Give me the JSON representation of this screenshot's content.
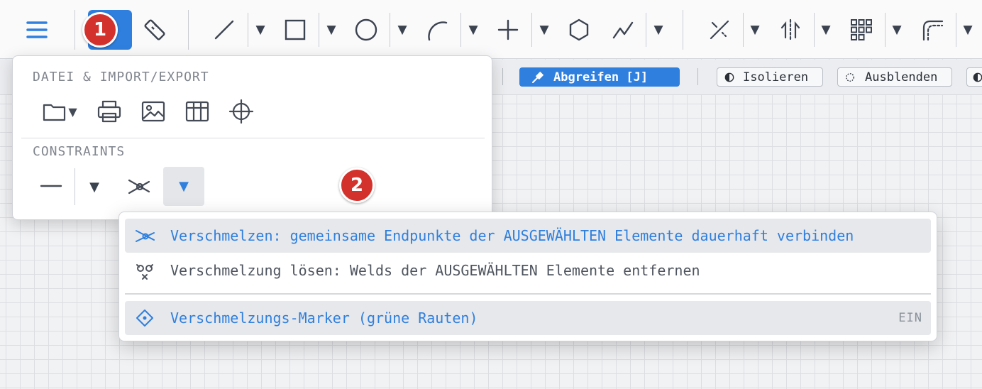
{
  "badges": {
    "one": "1",
    "two": "2"
  },
  "toolbar": {
    "menu_icon": "hamburger-icon",
    "items": [
      {
        "name": "measure-tool",
        "icon": "ruler-icon"
      },
      {
        "name": "line-tool",
        "icon": "line-icon"
      },
      {
        "name": "rectangle-tool",
        "icon": "rectangle-icon"
      },
      {
        "name": "circle-tool",
        "icon": "circle-icon"
      },
      {
        "name": "arc-tool",
        "icon": "arc-icon"
      },
      {
        "name": "point-tool",
        "icon": "crosshair-plus-icon"
      },
      {
        "name": "polygon-tool",
        "icon": "hexagon-icon"
      },
      {
        "name": "polyline-tool",
        "icon": "polyline-icon"
      },
      {
        "name": "trim-tool",
        "icon": "trim-icon"
      },
      {
        "name": "mirror-tool",
        "icon": "mirror-icon"
      },
      {
        "name": "array-tool",
        "icon": "grid-array-icon"
      },
      {
        "name": "fillet-tool",
        "icon": "fillet-icon"
      }
    ],
    "dropdown_glyph": "▼"
  },
  "subbar": {
    "pick_label": "Abgreifen [J]",
    "isolate_label": "Isolieren",
    "hide_label": "Ausblenden"
  },
  "panel": {
    "file_section_title": "DATEI & IMPORT/EXPORT",
    "constraints_title": "CONSTRAINTS",
    "file_icons": [
      "folder-icon",
      "print-icon",
      "image-icon",
      "table-icon",
      "crosshair-icon"
    ],
    "constraint_icons": [
      "horizontal-line-icon",
      "weld-icon"
    ],
    "dropdown_glyph": "▼"
  },
  "dropdown": {
    "items": [
      {
        "label": "Verschmelzen: gemeinsame Endpunkte der AUSGEWÄHLTEN Elemente dauerhaft verbinden",
        "icon": "weld-icon"
      },
      {
        "label": "Verschmelzung lösen: Welds der AUSGEWÄHLTEN Elemente entfernen",
        "icon": "unweld-icon"
      },
      {
        "label": "Verschmelzungs-Marker (grüne Rauten)",
        "icon": "diamond-marker-icon",
        "status": "EIN"
      }
    ]
  },
  "colors": {
    "accent": "#2f7fde",
    "badge": "#d3312c",
    "icon": "#454b56"
  }
}
